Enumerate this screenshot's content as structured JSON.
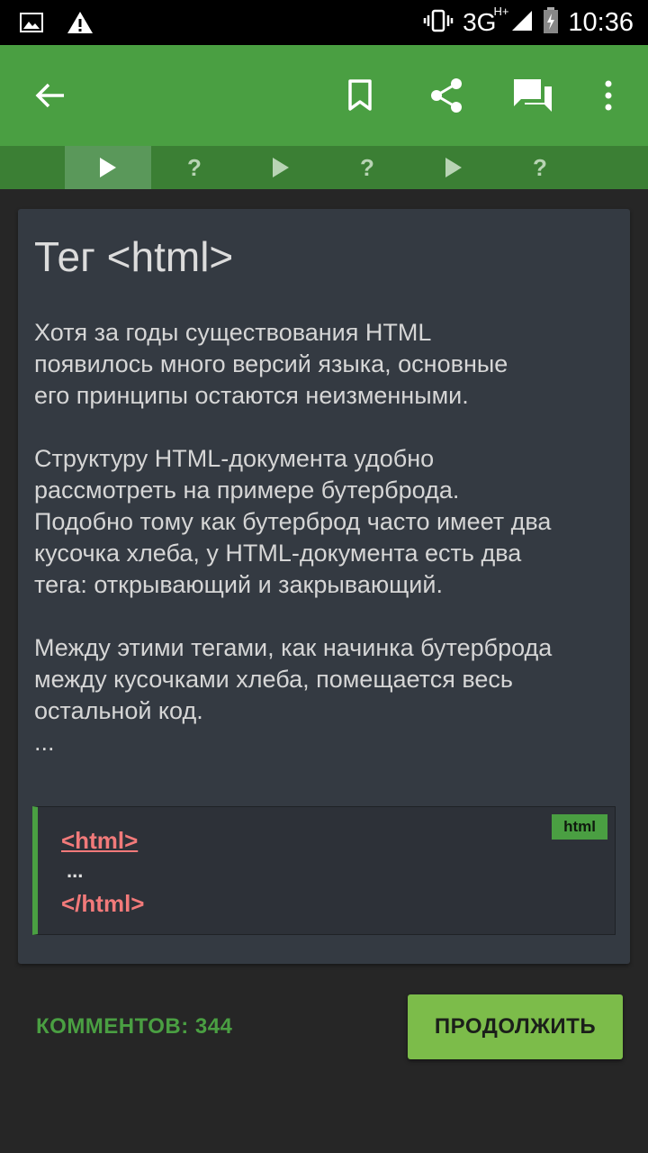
{
  "status_bar": {
    "time": "10:36",
    "network": "3G",
    "network_sup": "H+",
    "icons": [
      "image-notification-icon",
      "warning-icon",
      "vibrate-icon",
      "signal-icon",
      "battery-charging-icon"
    ]
  },
  "app_bar": {
    "icons": [
      "back-arrow-icon",
      "bookmark-icon",
      "share-icon",
      "comments-icon",
      "more-vert-icon"
    ],
    "color": "#4a9f42"
  },
  "steps": [
    {
      "type": "play",
      "active": true
    },
    {
      "type": "quiz",
      "label": "?"
    },
    {
      "type": "play"
    },
    {
      "type": "quiz",
      "label": "?"
    },
    {
      "type": "play"
    },
    {
      "type": "quiz",
      "label": "?"
    }
  ],
  "lesson": {
    "title": "Тег <html>",
    "body": "Хотя за годы существования HTML\nпоявилось много версий языка, основные\nего принципы остаются неизменными.\n\nСтруктуру HTML-документа удобно\nрассмотреть на примере бутерброда.\nПодобно тому как бутерброд часто имеет два\nкусочка хлеба, у HTML-документа есть два\nтега: открывающий и закрывающий.\n\nМежду этими тегами, как начинка бутерброда\nмежду кусочками хлеба, помещается весь\nостальной код.\n...",
    "code": {
      "badge": "html",
      "line1": "<html>",
      "line2": "...",
      "line3": "</html>"
    }
  },
  "footer": {
    "comments_label": "КОММЕНТОВ: 344",
    "continue_label": "ПРОДОЛЖИТЬ"
  }
}
